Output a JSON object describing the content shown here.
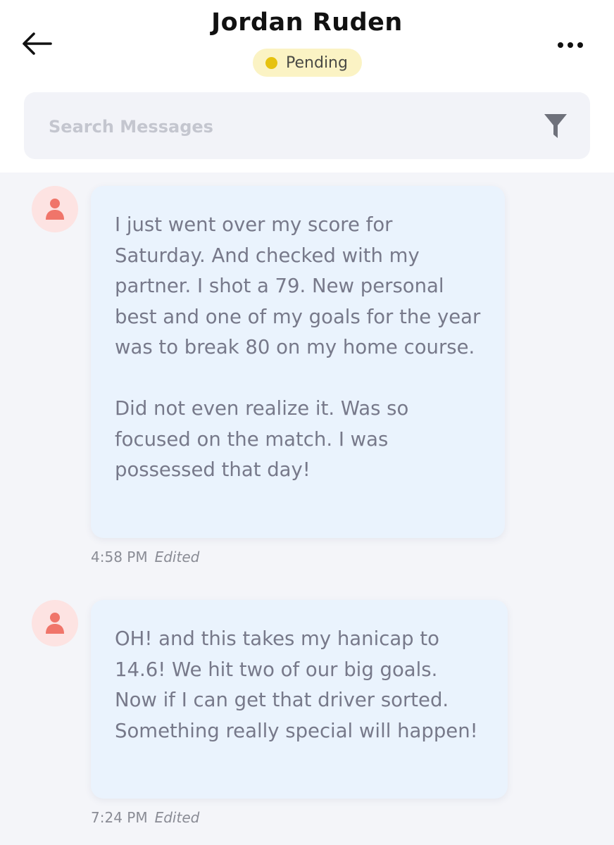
{
  "header": {
    "title": "Jordan Ruden",
    "status": "Pending",
    "status_color": "#e6c20f",
    "back_icon": "arrow-left-icon",
    "more_icon": "more-horizontal-icon"
  },
  "search": {
    "placeholder": "Search Messages",
    "value": "",
    "filter_icon": "filter-icon"
  },
  "messages": [
    {
      "avatar_icon": "user-icon",
      "paragraphs": [
        "I just went over my score for Saturday. And checked with my partner. I shot a 79. New personal best and one of my goals for the year was to break 80 on my home course.",
        "Did not even realize it. Was so focused on the match. I was possessed that day!"
      ],
      "time": "4:58 PM",
      "edited": "Edited"
    },
    {
      "avatar_icon": "user-icon",
      "paragraphs": [
        "OH! and this takes my hanicap to 14.6! We hit two of our big goals. Now if I can get that driver sorted. Something really special will happen!"
      ],
      "time": "7:24 PM",
      "edited": "Edited"
    }
  ],
  "colors": {
    "bubble_bg": "#eaf3fd",
    "avatar_bg": "#fde3e2",
    "avatar_icon": "#f0756a",
    "badge_bg": "#fbf3c4"
  }
}
